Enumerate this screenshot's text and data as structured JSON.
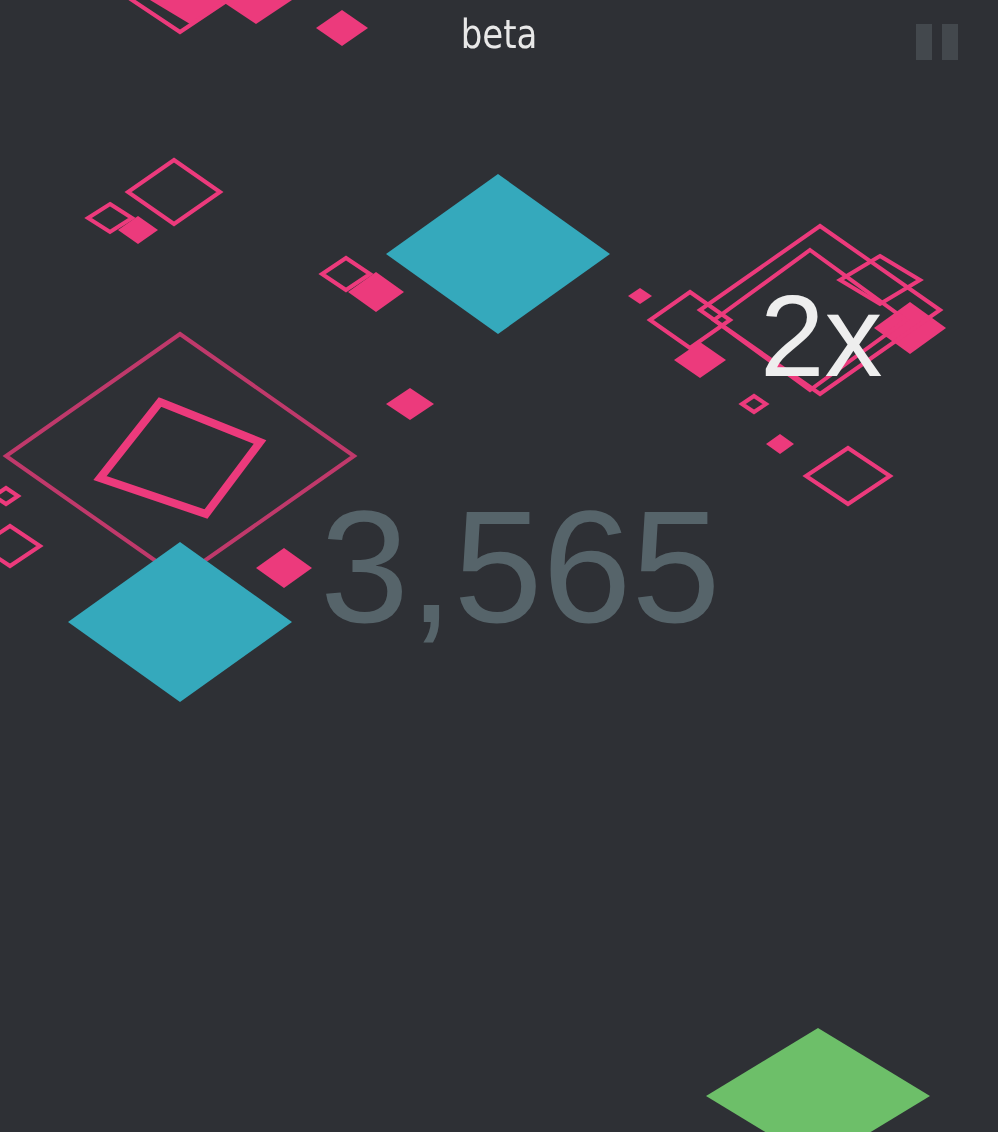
{
  "title": "beta",
  "multiplier": "2x",
  "score": "3,565"
}
